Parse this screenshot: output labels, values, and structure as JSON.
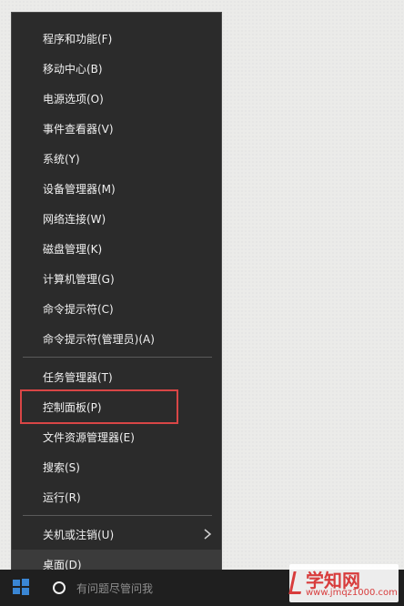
{
  "menu": {
    "items": [
      "程序和功能(F)",
      "移动中心(B)",
      "电源选项(O)",
      "事件查看器(V)",
      "系统(Y)",
      "设备管理器(M)",
      "网络连接(W)",
      "磁盘管理(K)",
      "计算机管理(G)",
      "命令提示符(C)",
      "命令提示符(管理员)(A)",
      "任务管理器(T)",
      "控制面板(P)",
      "文件资源管理器(E)",
      "搜索(S)",
      "运行(R)",
      "关机或注销(U)",
      "桌面(D)"
    ]
  },
  "taskbar": {
    "search_placeholder": "有问题尽管问我"
  },
  "watermark": {
    "brand": "学知网",
    "url": "www.jmqz1000.com"
  },
  "colors": {
    "menu_bg": "#2b2b2b",
    "highlight_border": "#d94646",
    "taskbar_bg": "#1f1f1f"
  }
}
